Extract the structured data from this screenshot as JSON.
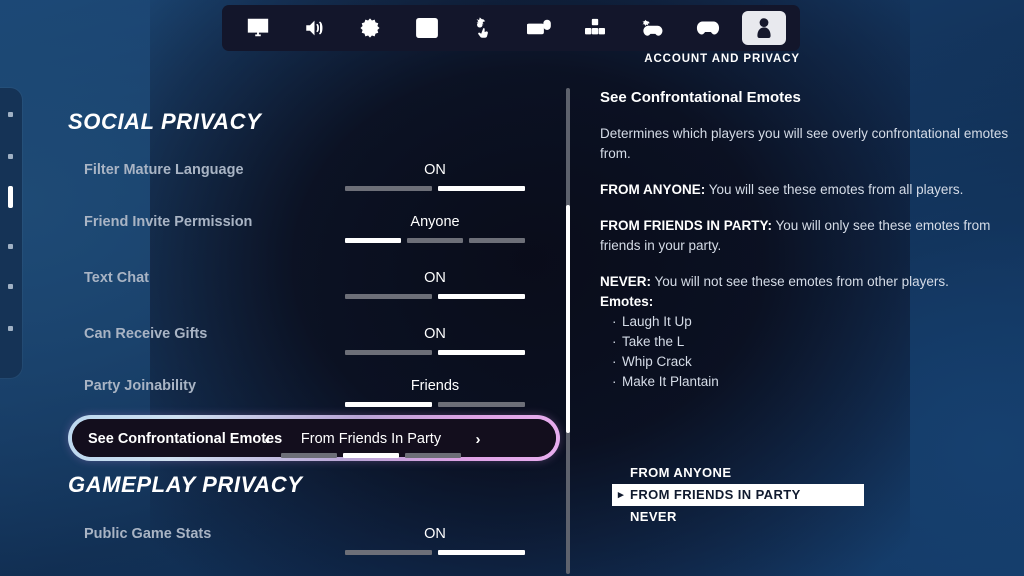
{
  "tabbar": {
    "caption": "ACCOUNT AND PRIVACY",
    "tabs": [
      {
        "icon": "monitor-icon",
        "name": "tab-video"
      },
      {
        "icon": "speaker-icon",
        "name": "tab-audio"
      },
      {
        "icon": "gear-icon",
        "name": "tab-game"
      },
      {
        "icon": "hud-layout-icon",
        "name": "tab-hud-layout"
      },
      {
        "icon": "accessibility-touch-icon",
        "name": "tab-accessibility"
      },
      {
        "icon": "keyboard-mouse-icon",
        "name": "tab-keyboard-mouse"
      },
      {
        "icon": "dpad-keybinds-icon",
        "name": "tab-controller-keybinds"
      },
      {
        "icon": "controller-gear-icon",
        "name": "tab-controller-config"
      },
      {
        "icon": "controller-icon",
        "name": "tab-controller"
      },
      {
        "icon": "person-icon",
        "name": "tab-account-and-privacy"
      }
    ],
    "active_index": 9
  },
  "edge_nav": {
    "dot_count": 6,
    "active_index": 2
  },
  "left_panel": {
    "sections": [
      {
        "title": "SOCIAL PRIVACY",
        "rows": [
          {
            "label": "Filter Mature Language",
            "value": "ON",
            "segments": 2,
            "active": 1
          },
          {
            "label": "Friend Invite Permission",
            "value": "Anyone",
            "segments": 3,
            "active": 0
          },
          {
            "label": "Text Chat",
            "value": "ON",
            "segments": 2,
            "active": 1
          },
          {
            "label": "Can Receive Gifts",
            "value": "ON",
            "segments": 2,
            "active": 1
          },
          {
            "label": "Party Joinability",
            "value": "Friends",
            "segments": 2,
            "active": 0
          }
        ]
      },
      {
        "title": "GAMEPLAY PRIVACY",
        "rows": [
          {
            "label": "Public Game Stats",
            "value": "ON",
            "segments": 2,
            "active": 1
          }
        ]
      }
    ],
    "selected_row": {
      "label": "See Confrontational Emotes",
      "value": "From Friends In Party",
      "segments": 3,
      "active": 1,
      "left_arrow": "‹",
      "right_arrow": "›",
      "border_color_start": "#bcd8ef",
      "border_color_end": "#e7aeee"
    }
  },
  "right_panel": {
    "heading": "See Confrontational Emotes",
    "description": "Determines which players you will see overly confrontational emotes from.",
    "entries": [
      {
        "term": "FROM ANYONE:",
        "text": " You will see these emotes from all players."
      },
      {
        "term": "FROM FRIENDS IN PARTY:",
        "text": " You will only see these emotes from friends in your party."
      },
      {
        "term": "NEVER:",
        "text": " You will not see these emotes from other players."
      }
    ],
    "emotes_label": "Emotes:",
    "emotes": [
      "Laugh It Up",
      "Take the L",
      "Whip Crack",
      "Make It Plantain"
    ]
  },
  "options": {
    "items": [
      "FROM ANYONE",
      "FROM FRIENDS IN PARTY",
      "NEVER"
    ],
    "selected_index": 1
  }
}
